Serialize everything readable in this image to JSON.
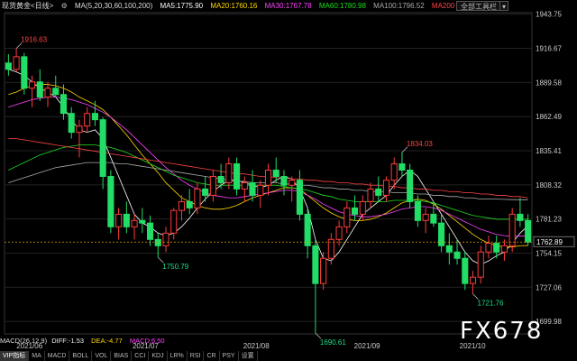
{
  "header": {
    "instrument": "现货黄金<日线>",
    "ma_params": "MA(5,20,30,60,100,200)",
    "ma5": "MA5:1775.90",
    "ma20": "MA20:1760.16",
    "ma30": "MA30:1767.78",
    "ma60": "MA60:1780.98",
    "ma100": "MA100:1796.52",
    "ma200": "MA200",
    "view_all_label": "全部工具栏",
    "colors": {
      "ma5": "#ffffff",
      "ma20": "#ffd700",
      "ma30": "#ff44ff",
      "ma60": "#22dd22",
      "ma100": "#aaaaaa",
      "ma200": "#ff4444"
    }
  },
  "indicator": {
    "label": "MACD(26,12,9)",
    "diff": "DIFF:-1.53",
    "dea": "DEA:-4.77",
    "macd": "MACD:6.50"
  },
  "bottom_tabs": [
    "VIP指标",
    "MA",
    "MACD",
    "BOLL",
    "VOL",
    "BIAS",
    "CCI",
    "KDJ",
    "LR%",
    "RSI",
    "CR",
    "PSY",
    "设置"
  ],
  "watermark": "FX678",
  "chart_data": {
    "type": "candlestick",
    "title": "现货黄金<日线>",
    "y_ticks": [
      "1943.75",
      "1916.67",
      "1889.58",
      "1862.49",
      "1835.41",
      "1808.32",
      "1781.23",
      "1754.15",
      "1727.06",
      "1699.98"
    ],
    "x_ticks": [
      "2021/06",
      "2021/07",
      "2021/08",
      "2021/09",
      "2021/10"
    ],
    "current_price": "1762.89",
    "annotations": [
      {
        "label": "1916.63",
        "kind": "high",
        "x": "2021/06 start",
        "price": 1916.63
      },
      {
        "label": "1750.79",
        "kind": "low",
        "x": "2021/06 end",
        "price": 1750.79
      },
      {
        "label": "1690.61",
        "kind": "low",
        "x": "2021/08",
        "price": 1690.61
      },
      {
        "label": "1834.03",
        "kind": "high",
        "x": "2021/09",
        "price": 1834.03
      },
      {
        "label": "1721.76",
        "kind": "low",
        "x": "2021/09 end",
        "price": 1721.76
      }
    ],
    "ylim": [
      1690,
      1945
    ],
    "candles": [
      [
        1905,
        1912,
        1895,
        1900
      ],
      [
        1900,
        1916.63,
        1898,
        1910
      ],
      [
        1910,
        1913,
        1880,
        1885
      ],
      [
        1885,
        1895,
        1870,
        1890
      ],
      [
        1890,
        1900,
        1875,
        1878
      ],
      [
        1878,
        1890,
        1870,
        1885
      ],
      [
        1885,
        1895,
        1878,
        1880
      ],
      [
        1880,
        1888,
        1860,
        1865
      ],
      [
        1865,
        1870,
        1845,
        1850
      ],
      [
        1850,
        1860,
        1830,
        1855
      ],
      [
        1855,
        1870,
        1850,
        1865
      ],
      [
        1865,
        1875,
        1855,
        1860
      ],
      [
        1860,
        1862,
        1805,
        1815
      ],
      [
        1815,
        1820,
        1770,
        1775
      ],
      [
        1775,
        1790,
        1765,
        1785
      ],
      [
        1785,
        1795,
        1770,
        1775
      ],
      [
        1775,
        1785,
        1765,
        1780
      ],
      [
        1780,
        1790,
        1770,
        1778
      ],
      [
        1778,
        1784,
        1760,
        1765
      ],
      [
        1765,
        1770,
        1750.79,
        1760
      ],
      [
        1760,
        1775,
        1755,
        1770
      ],
      [
        1770,
        1790,
        1765,
        1788
      ],
      [
        1788,
        1800,
        1780,
        1795
      ],
      [
        1795,
        1805,
        1785,
        1790
      ],
      [
        1790,
        1810,
        1785,
        1805
      ],
      [
        1805,
        1815,
        1795,
        1800
      ],
      [
        1800,
        1820,
        1795,
        1815
      ],
      [
        1815,
        1825,
        1805,
        1810
      ],
      [
        1810,
        1830,
        1805,
        1825
      ],
      [
        1825,
        1830,
        1800,
        1805
      ],
      [
        1805,
        1815,
        1795,
        1810
      ],
      [
        1810,
        1820,
        1795,
        1800
      ],
      [
        1800,
        1812,
        1790,
        1808
      ],
      [
        1808,
        1825,
        1800,
        1820
      ],
      [
        1820,
        1830,
        1810,
        1815
      ],
      [
        1815,
        1820,
        1800,
        1808
      ],
      [
        1808,
        1815,
        1795,
        1812
      ],
      [
        1812,
        1820,
        1780,
        1785
      ],
      [
        1785,
        1790,
        1750,
        1760
      ],
      [
        1760,
        1765,
        1690.61,
        1730
      ],
      [
        1730,
        1755,
        1725,
        1750
      ],
      [
        1750,
        1770,
        1745,
        1765
      ],
      [
        1765,
        1780,
        1760,
        1775
      ],
      [
        1775,
        1795,
        1770,
        1790
      ],
      [
        1790,
        1800,
        1780,
        1785
      ],
      [
        1785,
        1800,
        1780,
        1795
      ],
      [
        1795,
        1810,
        1790,
        1805
      ],
      [
        1805,
        1815,
        1795,
        1800
      ],
      [
        1800,
        1815,
        1795,
        1812
      ],
      [
        1812,
        1830,
        1805,
        1825
      ],
      [
        1825,
        1834.03,
        1815,
        1820
      ],
      [
        1820,
        1825,
        1790,
        1795
      ],
      [
        1795,
        1800,
        1775,
        1780
      ],
      [
        1780,
        1790,
        1770,
        1785
      ],
      [
        1785,
        1795,
        1775,
        1778
      ],
      [
        1778,
        1785,
        1755,
        1760
      ],
      [
        1760,
        1770,
        1745,
        1755
      ],
      [
        1755,
        1765,
        1745,
        1750
      ],
      [
        1750,
        1755,
        1725,
        1730
      ],
      [
        1730,
        1740,
        1721.76,
        1735
      ],
      [
        1735,
        1760,
        1730,
        1755
      ],
      [
        1755,
        1768,
        1750,
        1762
      ],
      [
        1762,
        1768,
        1750,
        1755
      ],
      [
        1755,
        1765,
        1748,
        1760
      ],
      [
        1760,
        1790,
        1755,
        1785
      ],
      [
        1785,
        1798,
        1775,
        1780
      ],
      [
        1780,
        1785,
        1760,
        1762.89
      ]
    ],
    "ma_series": [
      {
        "name": "MA5",
        "color": "#ffffff",
        "values": [
          1900,
          1898,
          1895,
          1890,
          1885,
          1882,
          1878,
          1870,
          1860,
          1852,
          1850,
          1852,
          1845,
          1830,
          1815,
          1800,
          1785,
          1778,
          1775,
          1770,
          1768,
          1770,
          1775,
          1782,
          1790,
          1797,
          1803,
          1808,
          1812,
          1812,
          1810,
          1808,
          1806,
          1808,
          1812,
          1815,
          1813,
          1805,
          1790,
          1765,
          1750,
          1748,
          1755,
          1765,
          1775,
          1785,
          1790,
          1795,
          1800,
          1808,
          1815,
          1820,
          1815,
          1805,
          1795,
          1785,
          1775,
          1765,
          1755,
          1748,
          1745,
          1748,
          1752,
          1755,
          1762,
          1770,
          1775.9
        ]
      },
      {
        "name": "MA20",
        "color": "#ffd700",
        "values": [
          1880,
          1882,
          1885,
          1887,
          1888,
          1888,
          1887,
          1885,
          1882,
          1878,
          1875,
          1872,
          1868,
          1862,
          1855,
          1848,
          1840,
          1832,
          1825,
          1818,
          1810,
          1804,
          1798,
          1795,
          1792,
          1790,
          1789,
          1789,
          1790,
          1792,
          1795,
          1798,
          1800,
          1802,
          1804,
          1806,
          1806,
          1805,
          1800,
          1795,
          1790,
          1786,
          1783,
          1781,
          1780,
          1780,
          1781,
          1783,
          1786,
          1790,
          1794,
          1796,
          1797,
          1796,
          1793,
          1789,
          1784,
          1779,
          1774,
          1769,
          1765,
          1762,
          1760,
          1759,
          1759,
          1760,
          1760.16
        ]
      },
      {
        "name": "MA30",
        "color": "#ff44ff",
        "values": [
          1870,
          1872,
          1874,
          1876,
          1877,
          1878,
          1878,
          1877,
          1876,
          1874,
          1872,
          1869,
          1866,
          1862,
          1857,
          1852,
          1846,
          1840,
          1834,
          1828,
          1822,
          1817,
          1812,
          1808,
          1805,
          1802,
          1800,
          1799,
          1798,
          1798,
          1799,
          1800,
          1801,
          1802,
          1803,
          1804,
          1804,
          1803,
          1800,
          1797,
          1793,
          1790,
          1787,
          1785,
          1784,
          1783,
          1783,
          1784,
          1785,
          1787,
          1789,
          1790,
          1791,
          1791,
          1790,
          1788,
          1785,
          1782,
          1779,
          1776,
          1773,
          1771,
          1769,
          1768,
          1767.5,
          1767.6,
          1767.78
        ]
      },
      {
        "name": "MA60",
        "color": "#22dd22",
        "values": [
          1820,
          1823,
          1826,
          1829,
          1832,
          1834,
          1836,
          1838,
          1839,
          1840,
          1840,
          1840,
          1839,
          1838,
          1836,
          1834,
          1831,
          1828,
          1825,
          1822,
          1819,
          1816,
          1814,
          1812,
          1810,
          1809,
          1808,
          1808,
          1808,
          1808,
          1808,
          1808,
          1808,
          1808,
          1808,
          1807,
          1806,
          1805,
          1804,
          1802,
          1800,
          1799,
          1797,
          1796,
          1795,
          1795,
          1795,
          1795,
          1795,
          1796,
          1796,
          1796,
          1796,
          1795,
          1794,
          1792,
          1790,
          1788,
          1786,
          1784,
          1783,
          1782,
          1781,
          1781,
          1781,
          1781,
          1780.98
        ]
      },
      {
        "name": "MA100",
        "color": "#aaaaaa",
        "values": [
          1810,
          1812,
          1814,
          1816,
          1818,
          1820,
          1822,
          1823,
          1824,
          1825,
          1826,
          1826,
          1826,
          1826,
          1825,
          1825,
          1824,
          1823,
          1822,
          1821,
          1820,
          1819,
          1818,
          1817,
          1816,
          1815,
          1814,
          1813,
          1812,
          1811,
          1811,
          1810,
          1810,
          1810,
          1810,
          1809,
          1809,
          1808,
          1808,
          1807,
          1806,
          1806,
          1805,
          1805,
          1804,
          1804,
          1803,
          1803,
          1803,
          1802,
          1802,
          1802,
          1801,
          1801,
          1800,
          1800,
          1799,
          1799,
          1798,
          1798,
          1797,
          1797,
          1797,
          1796.8,
          1796.6,
          1796.5,
          1796.52
        ]
      },
      {
        "name": "MA200",
        "color": "#ff4444",
        "values": [
          1845,
          1845,
          1844,
          1843,
          1842,
          1841,
          1840,
          1839,
          1838,
          1837,
          1836,
          1835,
          1834,
          1833,
          1832,
          1831,
          1830,
          1829,
          1828,
          1827,
          1826,
          1825,
          1824,
          1823,
          1822,
          1821,
          1820,
          1819,
          1818,
          1817,
          1817,
          1816,
          1815,
          1815,
          1814,
          1814,
          1813,
          1813,
          1812,
          1812,
          1811,
          1811,
          1810,
          1810,
          1809,
          1809,
          1808,
          1808,
          1807,
          1807,
          1806,
          1806,
          1805,
          1805,
          1804,
          1804,
          1803,
          1803,
          1802,
          1802,
          1801,
          1801,
          1800,
          1800,
          1799,
          1799,
          1798
        ]
      }
    ]
  }
}
